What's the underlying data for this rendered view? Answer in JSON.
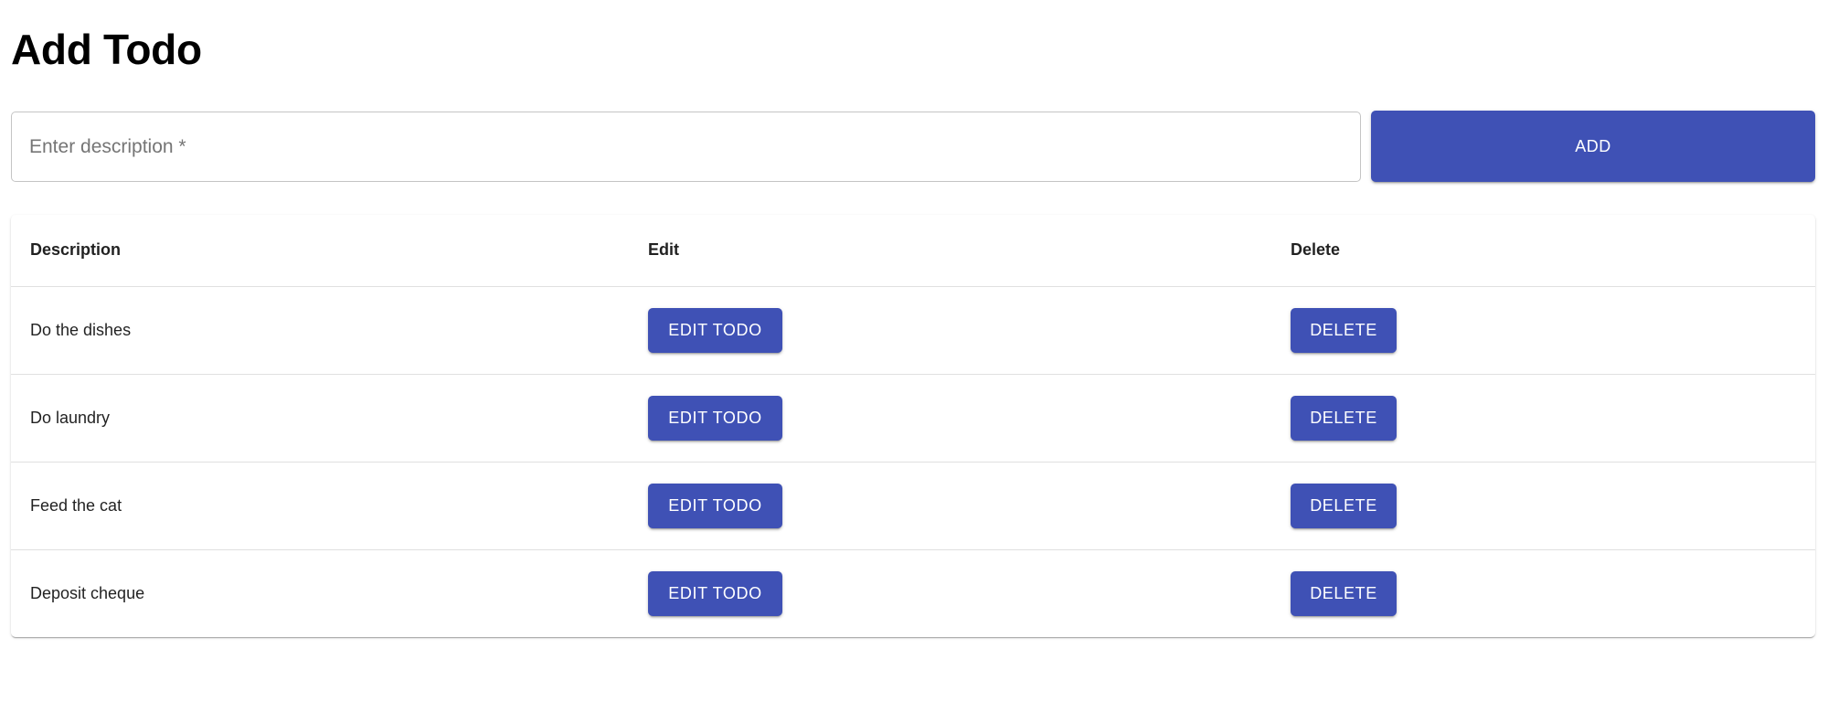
{
  "header": {
    "title": "Add Todo"
  },
  "form": {
    "description_placeholder": "Enter description *",
    "description_value": "",
    "add_label": "ADD"
  },
  "table": {
    "columns": [
      "Description",
      "Edit",
      "Delete"
    ],
    "rows": [
      {
        "description": "Do the dishes",
        "edit_label": "EDIT TODO",
        "delete_label": "DELETE"
      },
      {
        "description": "Do laundry",
        "edit_label": "EDIT TODO",
        "delete_label": "DELETE"
      },
      {
        "description": "Feed the cat",
        "edit_label": "EDIT TODO",
        "delete_label": "DELETE"
      },
      {
        "description": "Deposit cheque",
        "edit_label": "EDIT TODO",
        "delete_label": "DELETE"
      }
    ]
  },
  "theme": {
    "primary": "#3f51b5",
    "primary_text": "#ffffff",
    "placeholder": "#757575",
    "divider": "#e0e0e0"
  }
}
